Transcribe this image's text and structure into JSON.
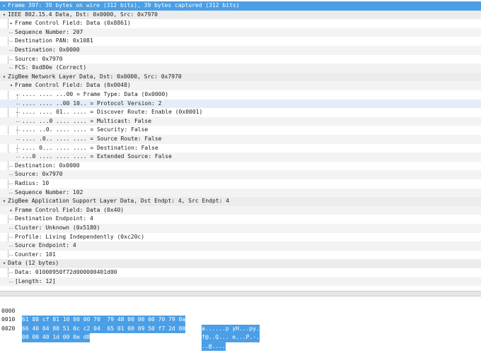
{
  "tree": [
    {
      "arrow": "▸",
      "text": "Frame 397: 39 bytes on wire (312 bits), 39 bytes captured (312 bits)"
    },
    {
      "arrow": "▾",
      "text": "IEEE 802.15.4 Data, Dst: 0x0000, Src: 0x7970"
    },
    {
      "arrow": "▸",
      "text": "Frame Control Field: Data (0x8861)"
    },
    {
      "arrow": "",
      "text": "Sequence Number: 207"
    },
    {
      "arrow": "",
      "text": "Destination PAN: 0x1081"
    },
    {
      "arrow": "",
      "text": "Destination: 0x0000"
    },
    {
      "arrow": "",
      "text": "Source: 0x7970"
    },
    {
      "arrow": "",
      "text": "FCS: 0xd80e (Correct)"
    },
    {
      "arrow": "▾",
      "text": "ZigBee Network Layer Data, Dst: 0x0000, Src: 0x7970"
    },
    {
      "arrow": "▾",
      "text": "Frame Control Field: Data (0x0048)"
    },
    {
      "arrow": "",
      "text": ".... .... ...00 = Frame Type: Data (0x0000)"
    },
    {
      "arrow": "",
      "text": ".... .... ..00 10.. = Protocol Version: 2"
    },
    {
      "arrow": "",
      "text": ".... .... 01.. .... = Discover Route: Enable (0x0001)"
    },
    {
      "arrow": "",
      "text": ".... ...0 .... .... = Multicast: False"
    },
    {
      "arrow": "",
      "text": ".... ..0. .... .... = Security: False"
    },
    {
      "arrow": "",
      "text": ".... .0.. .... .... = Source Route: False"
    },
    {
      "arrow": "",
      "text": ".... 0... .... .... = Destination: False"
    },
    {
      "arrow": "",
      "text": "...0 .... .... .... = Extended Source: False"
    },
    {
      "arrow": "",
      "text": "Destination: 0x0000"
    },
    {
      "arrow": "",
      "text": "Source: 0x7970"
    },
    {
      "arrow": "",
      "text": "Radius: 10"
    },
    {
      "arrow": "",
      "text": "Sequence Number: 102"
    },
    {
      "arrow": "▾",
      "text": "ZigBee Application Support Layer Data, Dst Endpt: 4, Src Endpt: 4"
    },
    {
      "arrow": "▸",
      "text": "Frame Control Field: Data (0x40)"
    },
    {
      "arrow": "",
      "text": "Destination Endpoint: 4"
    },
    {
      "arrow": "",
      "text": "Cluster: Unknown (0x5180)"
    },
    {
      "arrow": "",
      "text": "Profile: Living Independently (0xc20c)"
    },
    {
      "arrow": "",
      "text": "Source Endpoint: 4"
    },
    {
      "arrow": "",
      "text": "Counter: 101"
    },
    {
      "arrow": "▾",
      "text": "Data (12 bytes)"
    },
    {
      "arrow": "",
      "text": "Data: 01000950f72d000000401d00"
    },
    {
      "arrow": "",
      "text": "[Length: 12]"
    }
  ],
  "hex": [
    {
      "offset": "0000",
      "bytes": "61 88 cf 81 10 00 00 70  79 48 00 00 00 70 79 0a",
      "ascii": "a......p yH...py."
    },
    {
      "offset": "0010",
      "bytes": "66 40 04 80 51 0c c2 04  65 01 00 09 50 f7 2d 00",
      "ascii": "f@..Q... e...P.-."
    },
    {
      "offset": "0020",
      "bytes": "00 00 40 1d 00 0e d8",
      "ascii": "..@...."
    }
  ],
  "colors": {
    "selection": "#4a9fe6",
    "highlight": "#e3eef8",
    "section": "#ececec"
  }
}
